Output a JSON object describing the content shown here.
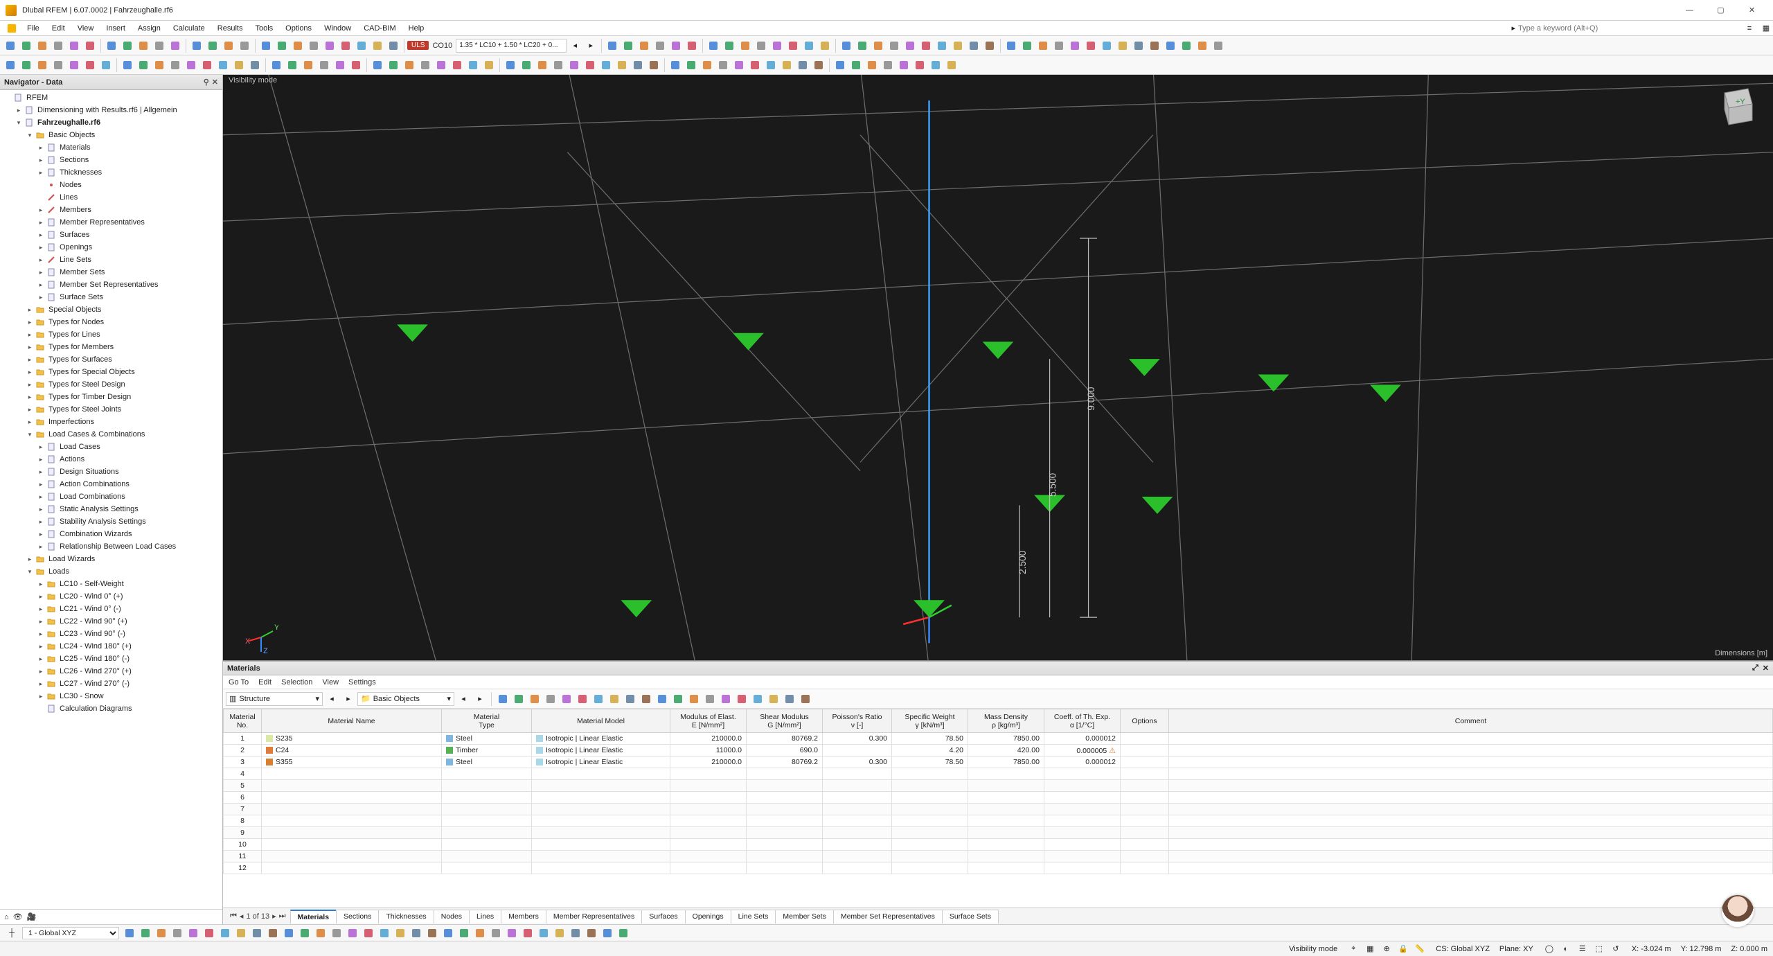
{
  "app": {
    "title": "Dlubal RFEM | 6.07.0002 | Fahrzeughalle.rf6"
  },
  "menu": [
    "File",
    "Edit",
    "View",
    "Insert",
    "Assign",
    "Calculate",
    "Results",
    "Tools",
    "Options",
    "Window",
    "CAD-BIM",
    "Help"
  ],
  "search_placeholder": "Type a keyword (Alt+Q)",
  "combo": {
    "uls": "ULS",
    "co": "CO10",
    "expr": "1.35 * LC10 + 1.50 * LC20 + 0..."
  },
  "nav": {
    "title": "Navigator - Data",
    "root": "RFEM",
    "proj1": "Dimensioning with Results.rf6 | Allgemein",
    "proj2": "Fahrzeughalle.rf6",
    "basic": "Basic Objects",
    "basic_items": [
      "Materials",
      "Sections",
      "Thicknesses",
      "Nodes",
      "Lines",
      "Members",
      "Member Representatives",
      "Surfaces",
      "Openings",
      "Line Sets",
      "Member Sets",
      "Member Set Representatives",
      "Surface Sets"
    ],
    "groups": [
      "Special Objects",
      "Types for Nodes",
      "Types for Lines",
      "Types for Members",
      "Types for Surfaces",
      "Types for Special Objects",
      "Types for Steel Design",
      "Types for Timber Design",
      "Types for Steel Joints",
      "Imperfections"
    ],
    "lcc": "Load Cases & Combinations",
    "lcc_items": [
      "Load Cases",
      "Actions",
      "Design Situations",
      "Action Combinations",
      "Load Combinations",
      "Static Analysis Settings",
      "Stability Analysis Settings",
      "Combination Wizards",
      "Relationship Between Load Cases"
    ],
    "lw": "Load Wizards",
    "loads": "Loads",
    "load_items": [
      "LC10 - Self-Weight",
      "LC20 - Wind 0° (+)",
      "LC21 - Wind 0° (-)",
      "LC22 - Wind 90° (+)",
      "LC23 - Wind 90° (-)",
      "LC24 - Wind 180° (+)",
      "LC25 - Wind 180° (-)",
      "LC26 - Wind 270° (+)",
      "LC27 - Wind 270° (-)",
      "LC30 - Snow"
    ],
    "calc": "Calculation Diagrams"
  },
  "viewport": {
    "mode": "Visibility mode",
    "dims": "Dimensions [m]",
    "d1": "9.000",
    "d2": "5.500",
    "d3": "2.500"
  },
  "materials": {
    "title": "Materials",
    "menu": [
      "Go To",
      "Edit",
      "Selection",
      "View",
      "Settings"
    ],
    "sel1": "Structure",
    "sel2": "Basic Objects",
    "head": {
      "no": "Material\nNo.",
      "name": "Material Name",
      "type": "Material\nType",
      "model": "Material Model",
      "e": "Modulus of Elast.\nE [N/mm²]",
      "g": "Shear Modulus\nG [N/mm²]",
      "nu": "Poisson's Ratio\nν [-]",
      "gamma": "Specific Weight\nγ [kN/m³]",
      "rho": "Mass Density\nρ [kg/m³]",
      "alpha": "Coeff. of Th. Exp.\nα [1/°C]",
      "opt": "Options",
      "cmt": "Comment"
    },
    "rows": [
      {
        "no": "1",
        "name": "S235",
        "type": "Steel",
        "model": "Isotropic | Linear Elastic",
        "e": "210000.0",
        "g": "80769.2",
        "nu": "0.300",
        "gamma": "78.50",
        "rho": "7850.00",
        "alpha": "0.000012",
        "sw": "#d9e8a3",
        "tsw": "#7fb6e0"
      },
      {
        "no": "2",
        "name": "C24",
        "type": "Timber",
        "model": "Isotropic | Linear Elastic",
        "e": "11000.0",
        "g": "690.0",
        "nu": "",
        "gamma": "4.20",
        "rho": "420.00",
        "alpha": "0.000005",
        "sw": "#e07b3a",
        "tsw": "#57b257",
        "warn": true
      },
      {
        "no": "3",
        "name": "S355",
        "type": "Steel",
        "model": "Isotropic | Linear Elastic",
        "e": "210000.0",
        "g": "80769.2",
        "nu": "0.300",
        "gamma": "78.50",
        "rho": "7850.00",
        "alpha": "0.000012",
        "sw": "#d98030",
        "tsw": "#7fb6e0"
      }
    ],
    "page": "1 of 13",
    "tabs": [
      "Materials",
      "Sections",
      "Thicknesses",
      "Nodes",
      "Lines",
      "Members",
      "Member Representatives",
      "Surfaces",
      "Openings",
      "Line Sets",
      "Member Sets",
      "Member Set Representatives",
      "Surface Sets"
    ]
  },
  "bottom": {
    "cs": "1 - Global XYZ"
  },
  "status": {
    "mode": "Visibility mode",
    "cs": "CS: Global XYZ",
    "plane": "Plane: XY",
    "x": "X: -3.024 m",
    "y": "Y: 12.798 m",
    "z": "Z: 0.000 m"
  }
}
